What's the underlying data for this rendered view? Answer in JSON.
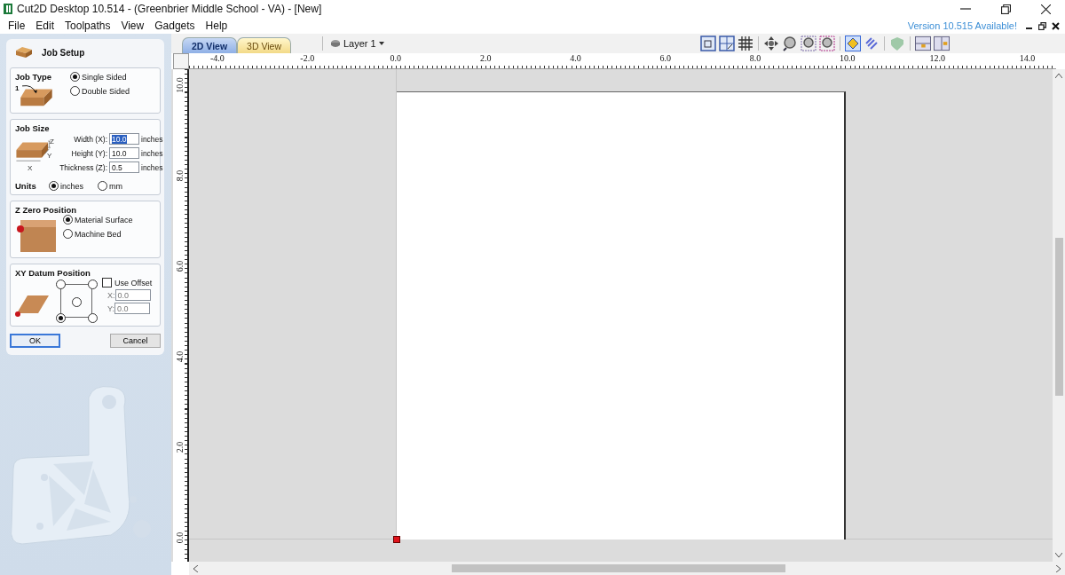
{
  "window": {
    "title": "Cut2D Desktop 10.514 - (Greenbrier Middle School - VA) - [New]"
  },
  "menu": [
    "File",
    "Edit",
    "Toolpaths",
    "View",
    "Gadgets",
    "Help"
  ],
  "update_notice": "Version 10.515 Available!",
  "job_setup": {
    "title": "Job Setup",
    "job_type": {
      "heading": "Job Type",
      "side_number": "1",
      "options": [
        {
          "label": "Single Sided",
          "selected": true
        },
        {
          "label": "Double Sided",
          "selected": false
        }
      ]
    },
    "job_size": {
      "heading": "Job Size",
      "axis_labels": [
        "Z",
        "Y",
        "X"
      ],
      "fields": [
        {
          "label": "Width (X):",
          "value": "10.0",
          "unit": "inches",
          "highlighted": true
        },
        {
          "label": "Height (Y):",
          "value": "10.0",
          "unit": "inches",
          "highlighted": false
        },
        {
          "label": "Thickness (Z):",
          "value": "0.5",
          "unit": "inches",
          "highlighted": false
        }
      ],
      "units_label": "Units",
      "units": [
        {
          "label": "inches",
          "selected": true
        },
        {
          "label": "mm",
          "selected": false
        }
      ]
    },
    "z_zero": {
      "heading": "Z Zero Position",
      "options": [
        {
          "label": "Material Surface",
          "selected": true
        },
        {
          "label": "Machine Bed",
          "selected": false
        }
      ]
    },
    "xy_datum": {
      "heading": "XY Datum Position",
      "points": [
        {
          "selected": false
        },
        {
          "selected": false
        },
        {
          "selected": false
        },
        {
          "selected": true
        },
        {
          "selected": false
        }
      ],
      "use_offset": {
        "label": "Use Offset",
        "checked": false
      },
      "offset_fields": [
        {
          "label": "X:",
          "value": "0.0",
          "disabled": true
        },
        {
          "label": "Y:",
          "value": "0.0",
          "disabled": true
        }
      ]
    },
    "buttons": [
      {
        "label": "OK",
        "default": true
      },
      {
        "label": "Cancel",
        "default": false
      }
    ]
  },
  "view_tabs": [
    {
      "label": "2D View",
      "selected": true
    },
    {
      "label": "3D View",
      "selected": false
    }
  ],
  "layer": "Layer 1",
  "ruler": {
    "x_labels": [
      "-4.0",
      "-2.0",
      "0.0",
      "2.0",
      "4.0",
      "6.0",
      "8.0",
      "10.0",
      "12.0",
      "14.0"
    ],
    "y_labels": [
      "10.0",
      "8.0",
      "6.0",
      "4.0",
      "2.0",
      "0.0"
    ]
  }
}
